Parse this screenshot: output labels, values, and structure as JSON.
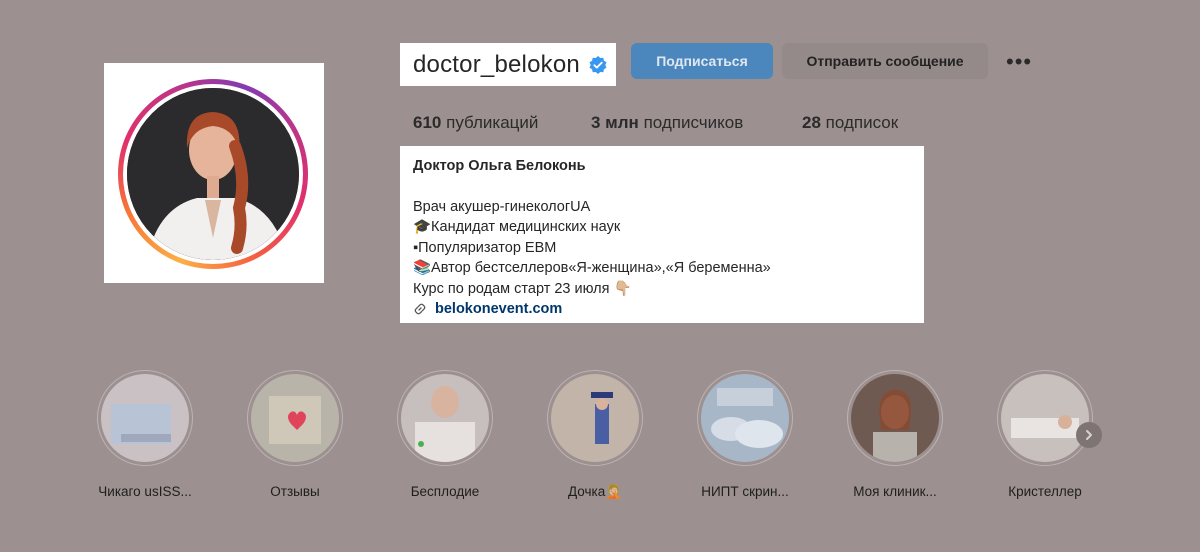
{
  "profile": {
    "username": "doctor_belokon",
    "follow_label": "Подписаться",
    "message_label": "Отправить сообщение",
    "more_label": "•••"
  },
  "stats": {
    "posts_count": "610",
    "posts_label": "публикаций",
    "followers_count": "3 млн",
    "followers_label": "подписчиков",
    "following_count": "28",
    "following_label": "подписок"
  },
  "bio": {
    "name": "Доктор Ольга Белоконь",
    "lines": [
      "Врач акушер-гинекологUA",
      "🎓Кандидат медицинских наук",
      "▪Популяризатор EBM",
      "📚Автор бестселлеров«Я-женщина»,«Я беременна»",
      "Курс по родам старт 23 июля 👇🏼"
    ],
    "link": "belokonevent.com"
  },
  "highlights": [
    {
      "label": "Чикаго usISS..."
    },
    {
      "label": "Отзывы"
    },
    {
      "label": "Бесплодие"
    },
    {
      "label": "Дочка🤦🏼"
    },
    {
      "label": "НИПТ скрин..."
    },
    {
      "label": "Моя клиник..."
    },
    {
      "label": "Кристеллер"
    }
  ],
  "colors": {
    "background": "#9c9090",
    "follow_button": "#4b86bd",
    "message_button": "#958a8a",
    "verified": "#3897f0",
    "link": "#00376b"
  }
}
